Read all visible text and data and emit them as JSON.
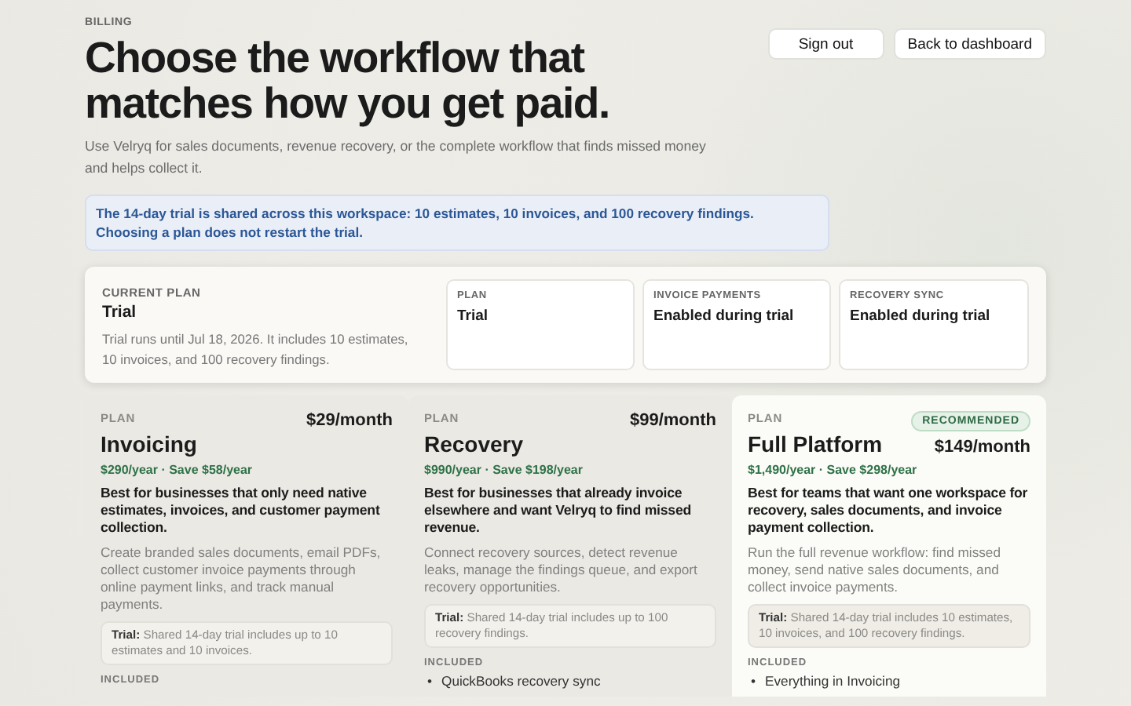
{
  "section_label": "BILLING",
  "title": "Choose the workflow that matches how you get paid.",
  "subtitle": "Use Velryq for sales documents, revenue recovery, or the complete workflow that finds missed money and helps collect it.",
  "actions": [
    {
      "label": "Sign out"
    },
    {
      "label": "Back to dashboard"
    }
  ],
  "notice": "The 14-day trial is shared across this workspace: 10 estimates, 10 invoices, and 100 recovery findings. Choosing a plan does not restart the trial.",
  "current_plan": {
    "label": "CURRENT PLAN",
    "name": "Trial",
    "description": "Trial runs until Jul 18, 2026. It includes 10 estimates, 10 invoices, and 100 recovery findings.",
    "stats": [
      {
        "label": "PLAN",
        "value": "Trial"
      },
      {
        "label": "INVOICE PAYMENTS",
        "value": "Enabled during trial"
      },
      {
        "label": "RECOVERY SYNC",
        "value": "Enabled during trial"
      }
    ]
  },
  "plans": [
    {
      "eyebrow": "PLAN",
      "name": "Invoicing",
      "price": "$29/month",
      "yearly": "$290/year · Save $58/year",
      "summary": "Best for businesses that only need native estimates, invoices, and customer payment collection.",
      "description": "Create branded sales documents, email PDFs, collect customer invoice payments through online payment links, and track manual payments.",
      "trial": "**Trial:** Shared 14-day trial includes up to 10 estimates and 10 invoices.",
      "included_label": "INCLUDED",
      "recommended": false
    },
    {
      "eyebrow": "PLAN",
      "name": "Recovery",
      "price": "$99/month",
      "yearly": "$990/year · Save $198/year",
      "summary": "Best for businesses that already invoice elsewhere and want Velryq to find missed revenue.",
      "description": "Connect recovery sources, detect revenue leaks, manage the findings queue, and export recovery opportunities.",
      "trial": "**Trial:** Shared 14-day trial includes up to 100 recovery findings.",
      "included_label": "INCLUDED",
      "features": [
        {
          "bullet": "•",
          "text": "QuickBooks recovery sync"
        }
      ],
      "recommended": false
    },
    {
      "eyebrow": "PLAN",
      "name": "Full Platform",
      "badge": "RECOMMENDED",
      "price": "$149/month",
      "yearly": "$1,490/year · Save $298/year",
      "summary": "Best for teams that want one workspace for recovery, sales documents, and invoice payment collection.",
      "description": "Run the full revenue workflow: find missed money, send native sales documents, and collect invoice payments.",
      "trial": "**Trial:** Shared 14-day trial includes 10 estimates, 10 invoices, and 100 recovery findings.",
      "included_label": "INCLUDED",
      "features": [
        {
          "bullet": "•",
          "text": "Everything in Invoicing"
        }
      ],
      "recommended": true
    }
  ]
}
